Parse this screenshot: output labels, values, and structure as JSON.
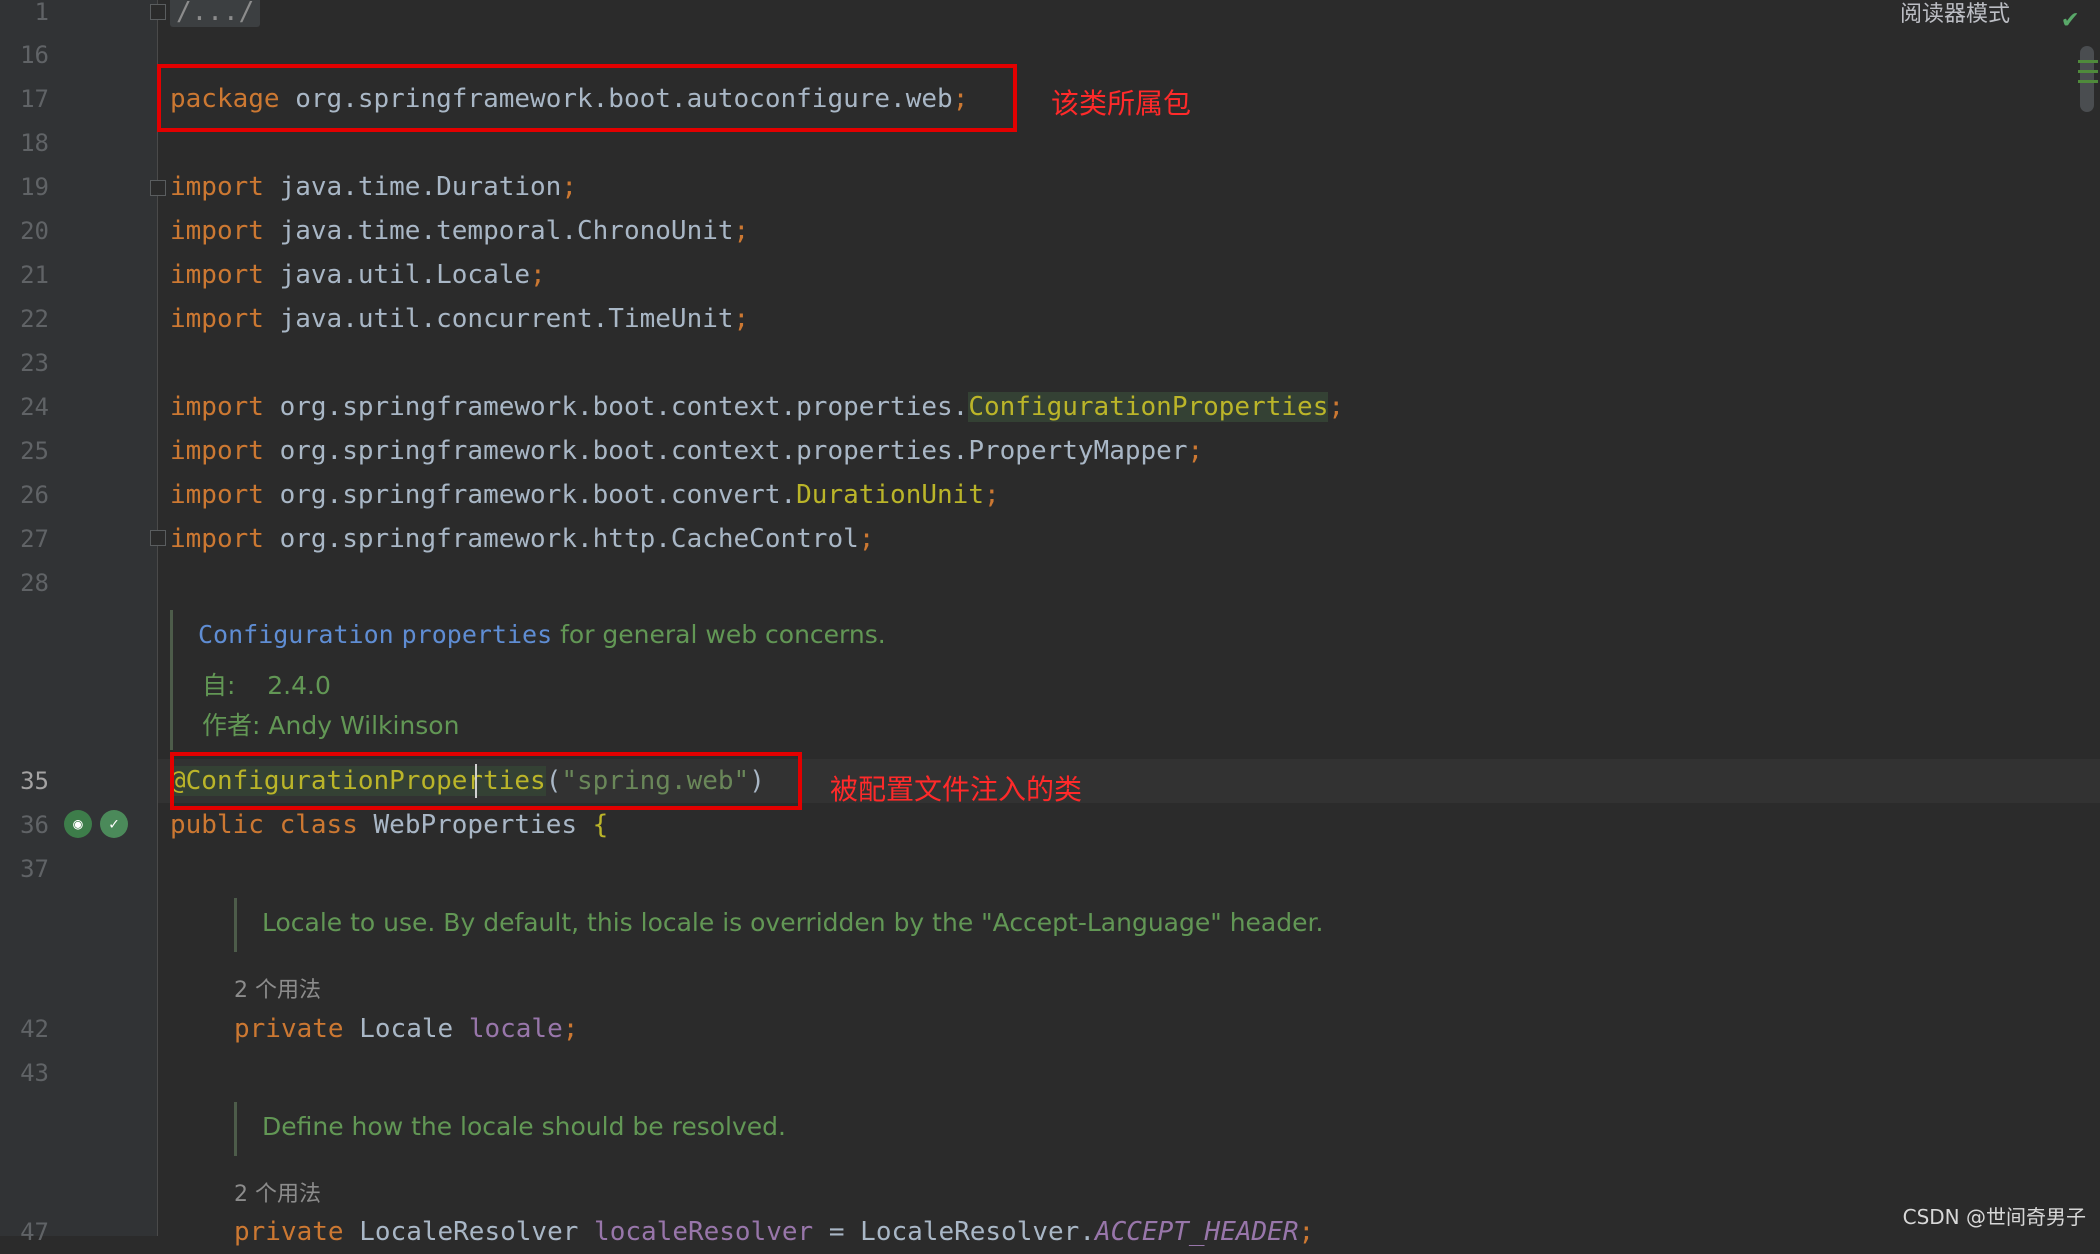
{
  "toolbar": {
    "reader_mode_label": "阅读器模式"
  },
  "gutter": {
    "line_numbers": [
      "1",
      "16",
      "17",
      "18",
      "19",
      "20",
      "21",
      "22",
      "23",
      "24",
      "25",
      "26",
      "27",
      "28",
      "35",
      "36",
      "37",
      "42",
      "43",
      "47"
    ]
  },
  "code": {
    "collapsed_header": "/.../",
    "package_kw": "package",
    "package_name": "org.springframework.boot.autoconfigure.web",
    "import_kw": "import",
    "imports": [
      {
        "path": "java.time.Duration",
        "cls": ""
      },
      {
        "path": "java.time.temporal.ChronoUnit",
        "cls": ""
      },
      {
        "path": "java.util.Locale",
        "cls": ""
      },
      {
        "path": "java.util.concurrent.TimeUnit",
        "cls": ""
      },
      {
        "path": "org.springframework.boot.context.properties.",
        "cls": "ConfigurationProperties"
      },
      {
        "path": "org.springframework.boot.context.properties.PropertyMapper",
        "cls": ""
      },
      {
        "path": "org.springframework.boot.convert.",
        "cls": "DurationUnit"
      },
      {
        "path": "org.springframework.http.CacheControl",
        "cls": ""
      }
    ],
    "semicolon": ";",
    "annotation": "@ConfigurationProperties",
    "annotation_arg": "\"spring.web\"",
    "public_kw": "public",
    "class_kw": "class",
    "class_name": "WebProperties",
    "open_brace": "{",
    "private_kw": "private",
    "locale_type": "Locale",
    "locale_field": "locale",
    "resolver_type": "LocaleResolver",
    "resolver_field": "localeResolver",
    "equals": "=",
    "resolver_const": "ACCEPT_HEADER"
  },
  "javadoc": {
    "class_doc_ref1": "Configuration",
    "class_doc_ref2": "properties",
    "class_doc_text": "for general web concerns.",
    "since_label": "自:",
    "since_value": "2.4.0",
    "author_label": "作者:",
    "author_value": "Andy Wilkinson",
    "locale_doc": "Locale to use. By default, this locale is overridden by the \"Accept-Language\" header.",
    "usage_locale": "2 个用法",
    "resolver_doc": "Define how the locale should be resolved.",
    "usage_resolver": "2 个用法"
  },
  "annotations": {
    "package_note": "该类所属包",
    "class_note": "被配置文件注入的类"
  },
  "watermark": "CSDN @世间奇男子",
  "colors": {
    "annotation_box": "#e30000",
    "annotation_text": "#ff2a2a",
    "keyword": "#cc7832",
    "string": "#6a8759",
    "field": "#9876aa",
    "doc": "#629755"
  }
}
